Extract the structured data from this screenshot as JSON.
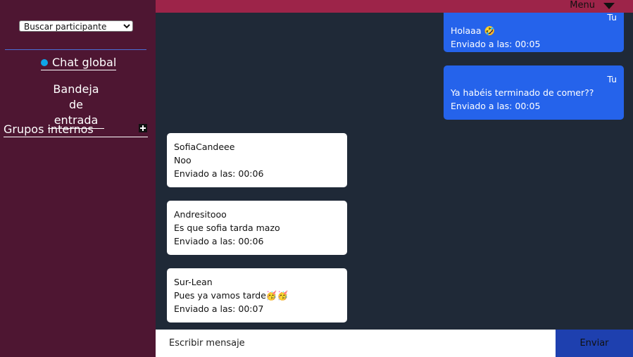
{
  "sidebar": {
    "search_select": {
      "selected": "Buscar participante"
    },
    "chat_global_label": "Chat global",
    "inbox_line1": "Bandeja",
    "inbox_line2": "de entrada",
    "groups_label": "Grupos internos"
  },
  "header": {
    "menu_label": "Menu"
  },
  "messages": [
    {
      "author": "Tu",
      "text": "Holaaa 🤣",
      "time": "Enviado a las: 00:05",
      "own": true
    },
    {
      "author": "Tu",
      "text": "Ya habéis terminado de comer??",
      "time": "Enviado a las: 00:05",
      "own": true
    },
    {
      "author": "SofiaCandeee",
      "text": "Noo",
      "time": "Enviado a las: 00:06",
      "own": false
    },
    {
      "author": "Andresitooo",
      "text": "Es que sofia tarda mazo",
      "time": "Enviado a las: 00:06",
      "own": false
    },
    {
      "author": "Sur-Lean",
      "text": "Pues ya vamos tarde🥳🥳",
      "time": "Enviado a las: 00:07",
      "own": false
    }
  ],
  "composer": {
    "placeholder": "Escribir mensaje",
    "send_label": "Enviar"
  },
  "colors": {
    "sidebar": "#4e1632",
    "topbar": "#9d2449",
    "chat_bg": "#1f2937",
    "own_bubble": "#2563eb",
    "send_button": "#1e40af"
  }
}
